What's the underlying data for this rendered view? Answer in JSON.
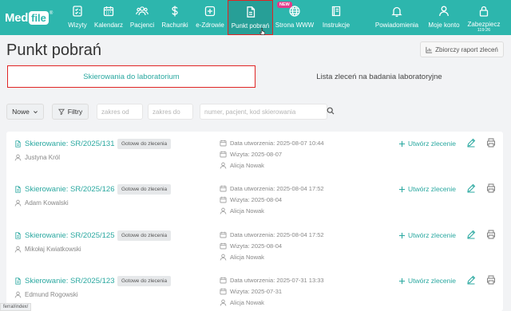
{
  "app": {
    "logo_med": "Med",
    "logo_file": "file",
    "logo_reg": "®"
  },
  "nav": {
    "items": [
      {
        "label": "Wizyty",
        "icon": "checklist-icon"
      },
      {
        "label": "Kalendarz",
        "icon": "calendar-icon"
      },
      {
        "label": "Pacjenci",
        "icon": "users-icon"
      },
      {
        "label": "Rachunki",
        "icon": "dollar-icon"
      },
      {
        "label": "e-Zdrowie",
        "icon": "medical-cross-icon"
      },
      {
        "label": "Punkt pobrań",
        "icon": "document-icon"
      },
      {
        "label": "Strona WWW",
        "icon": "globe-icon"
      },
      {
        "label": "Instrukcje",
        "icon": "book-icon"
      },
      {
        "label": "Powiadomienia",
        "icon": "bell-icon"
      },
      {
        "label": "Moje konto",
        "icon": "user-icon"
      },
      {
        "label": "Zabezpiecz",
        "icon": "lock-icon",
        "sub": "119:26"
      }
    ],
    "new_badge": "NEW"
  },
  "page": {
    "title": "Punkt pobrań",
    "report_button": "Zbiorczy raport zleceń"
  },
  "tabs": [
    {
      "label": "Skierowania do laboratorium"
    },
    {
      "label": "Lista zleceń na badania laboratoryjne"
    }
  ],
  "filters": {
    "status_dropdown": "Nowe",
    "filter_button": "Filtry",
    "date_from_placeholder": "zakres od",
    "date_to_placeholder": "zakres do",
    "search_placeholder": "numer, pacjent, kod skierowania"
  },
  "referrals": [
    {
      "title": "Skierowanie: SR/2025/131",
      "status": "Gotowe do zlecenia",
      "patient": "Justyna Król",
      "created": "Data utworzenia: 2025-08-07 10:44",
      "visit": "Wizyta: 2025-08-07",
      "doctor": "Alicja Nowak",
      "create_action": "Utwórz zlecenie"
    },
    {
      "title": "Skierowanie: SR/2025/126",
      "status": "Gotowe do zlecenia",
      "patient": "Adam Kowalski",
      "created": "Data utworzenia: 2025-08-04 17:52",
      "visit": "Wizyta: 2025-08-04",
      "doctor": "Alicja Nowak",
      "create_action": "Utwórz zlecenie"
    },
    {
      "title": "Skierowanie: SR/2025/125",
      "status": "Gotowe do zlecenia",
      "patient": "Mikołaj Kwiatkowski",
      "created": "Data utworzenia: 2025-08-04 17:52",
      "visit": "Wizyta: 2025-08-04",
      "doctor": "Alicja Nowak",
      "create_action": "Utwórz zlecenie"
    },
    {
      "title": "Skierowanie: SR/2025/123",
      "status": "Gotowe do zlecenia",
      "patient": "Edmund Rogowski",
      "created": "Data utworzenia: 2025-07-31 13:33",
      "visit": "Wizyta: 2025-07-31",
      "doctor": "Alicja Nowak",
      "create_action": "Utwórz zlecenie"
    }
  ],
  "status_bar": {
    "url": "ferral/index/"
  },
  "colors": {
    "brand": "#2db6ad",
    "accent_text": "#2aa8a0",
    "highlight_border": "#e02424",
    "new_badge": "#e23b8a"
  }
}
